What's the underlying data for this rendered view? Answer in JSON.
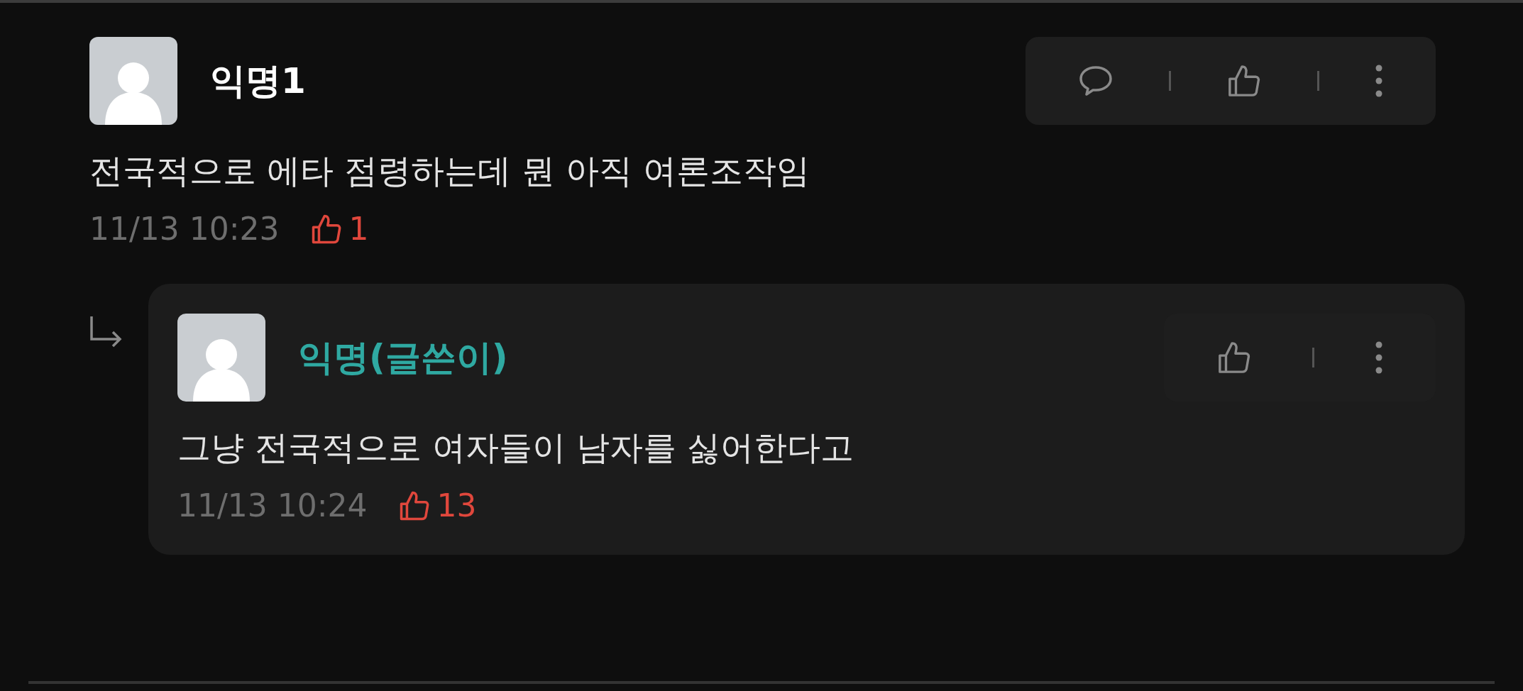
{
  "comments": [
    {
      "author": "익명1",
      "is_writer": false,
      "text": "전국적으로 에타 점령하는데 뭔 아직 여론조작임",
      "time": "11/13 10:23",
      "likes": "1",
      "actions": [
        {
          "kind": "comment"
        },
        {
          "kind": "like"
        },
        {
          "kind": "more"
        }
      ],
      "replies": [
        {
          "author": "익명(글쓴이)",
          "is_writer": true,
          "text": "그냥 전국적으로 여자들이 남자를 싫어한다고",
          "time": "11/13 10:24",
          "likes": "13",
          "actions": [
            {
              "kind": "like"
            },
            {
              "kind": "more"
            }
          ]
        }
      ]
    }
  ]
}
